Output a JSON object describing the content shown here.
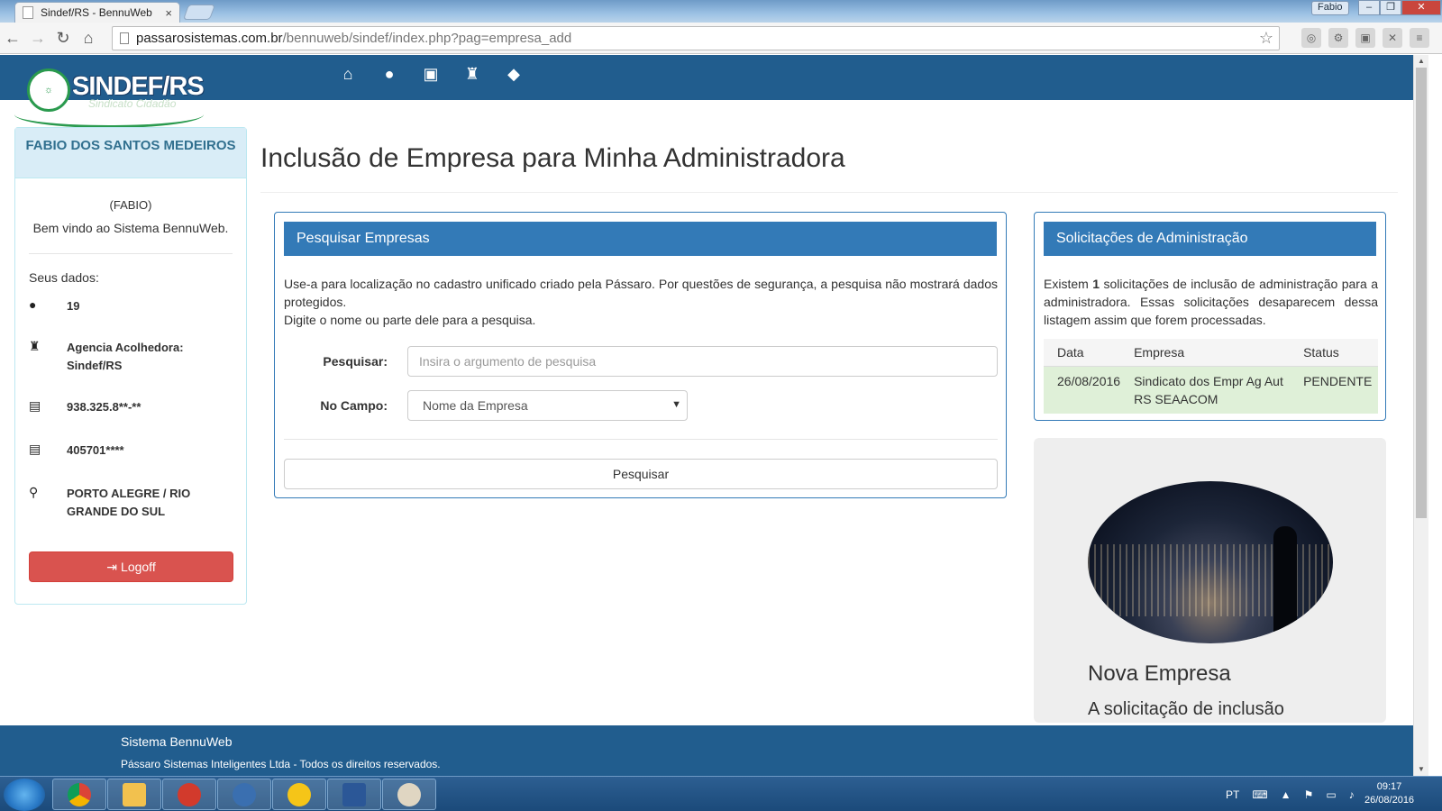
{
  "browser": {
    "tab_title": "Sindef/RS - BennuWeb",
    "tab_close": "×",
    "user_badge": "Fabio",
    "url_host": "passarosistemas.com.br",
    "url_path": "/bennuweb/sindef/index.php?pag=empresa_add"
  },
  "header": {
    "brand": "SINDEF/RS",
    "brand_sub": "Sindicato Cidadão",
    "nav_icons": [
      "home-icon",
      "user-icon",
      "briefcase-icon",
      "building-icon",
      "tags-icon"
    ]
  },
  "sidebar": {
    "user_name": "FABIO DOS SANTOS MEDEIROS",
    "nickname": "(FABIO)",
    "welcome": "Bem vindo ao Sistema BennuWeb.",
    "data_label": "Seus dados:",
    "fields": [
      {
        "icon": "user-icon",
        "value": "19"
      },
      {
        "icon": "building-icon",
        "value": "Agencia Acolhedora: Sindef/RS"
      },
      {
        "icon": "id-card-icon",
        "value": "938.325.8**-**"
      },
      {
        "icon": "id-card-icon",
        "value": "405701****"
      },
      {
        "icon": "map-marker-icon",
        "value": "PORTO ALEGRE / RIO GRANDE DO SUL"
      }
    ],
    "logoff_label": "Logoff"
  },
  "main": {
    "title": "Inclusão de Empresa para Minha Administradora",
    "search_panel": {
      "heading": "Pesquisar Empresas",
      "desc1": "Use-a para localização no cadastro unificado criado pela Pássaro. Por questões de segurança, a pesquisa não mostrará dados protegidos.",
      "desc2": "Digite o nome ou parte dele para a pesquisa.",
      "search_label": "Pesquisar:",
      "search_placeholder": "Insira o argumento de pesquisa",
      "field_label": "No Campo:",
      "field_selected": "Nome da Empresa",
      "submit_label": "Pesquisar"
    },
    "requests_panel": {
      "heading": "Solicitações de Administração",
      "desc_pre": "Existem ",
      "count": "1",
      "desc_post": " solicitações de inclusão de administração para a administradora. Essas solicitações desaparecem dessa listagem assim que forem processadas.",
      "columns": [
        "Data",
        "Empresa",
        "Status"
      ],
      "rows": [
        {
          "date": "26/08/2016",
          "company": "Sindicato dos Empr Ag Aut RS SEAACOM",
          "status": "PENDENTE"
        }
      ]
    },
    "promo": {
      "title": "Nova Empresa",
      "text": "A solicitação de inclusão"
    }
  },
  "footer": {
    "system": "Sistema BennuWeb",
    "copyright": "Pássaro Sistemas Inteligentes Ltda - Todos os direitos reservados."
  },
  "taskbar": {
    "lang": "PT",
    "time": "09:17",
    "date": "26/08/2016"
  },
  "colors": {
    "header_bg": "#215d8e",
    "panel_primary": "#337ab7",
    "logoff_red": "#d9534f",
    "success_row": "#dff0d8"
  }
}
